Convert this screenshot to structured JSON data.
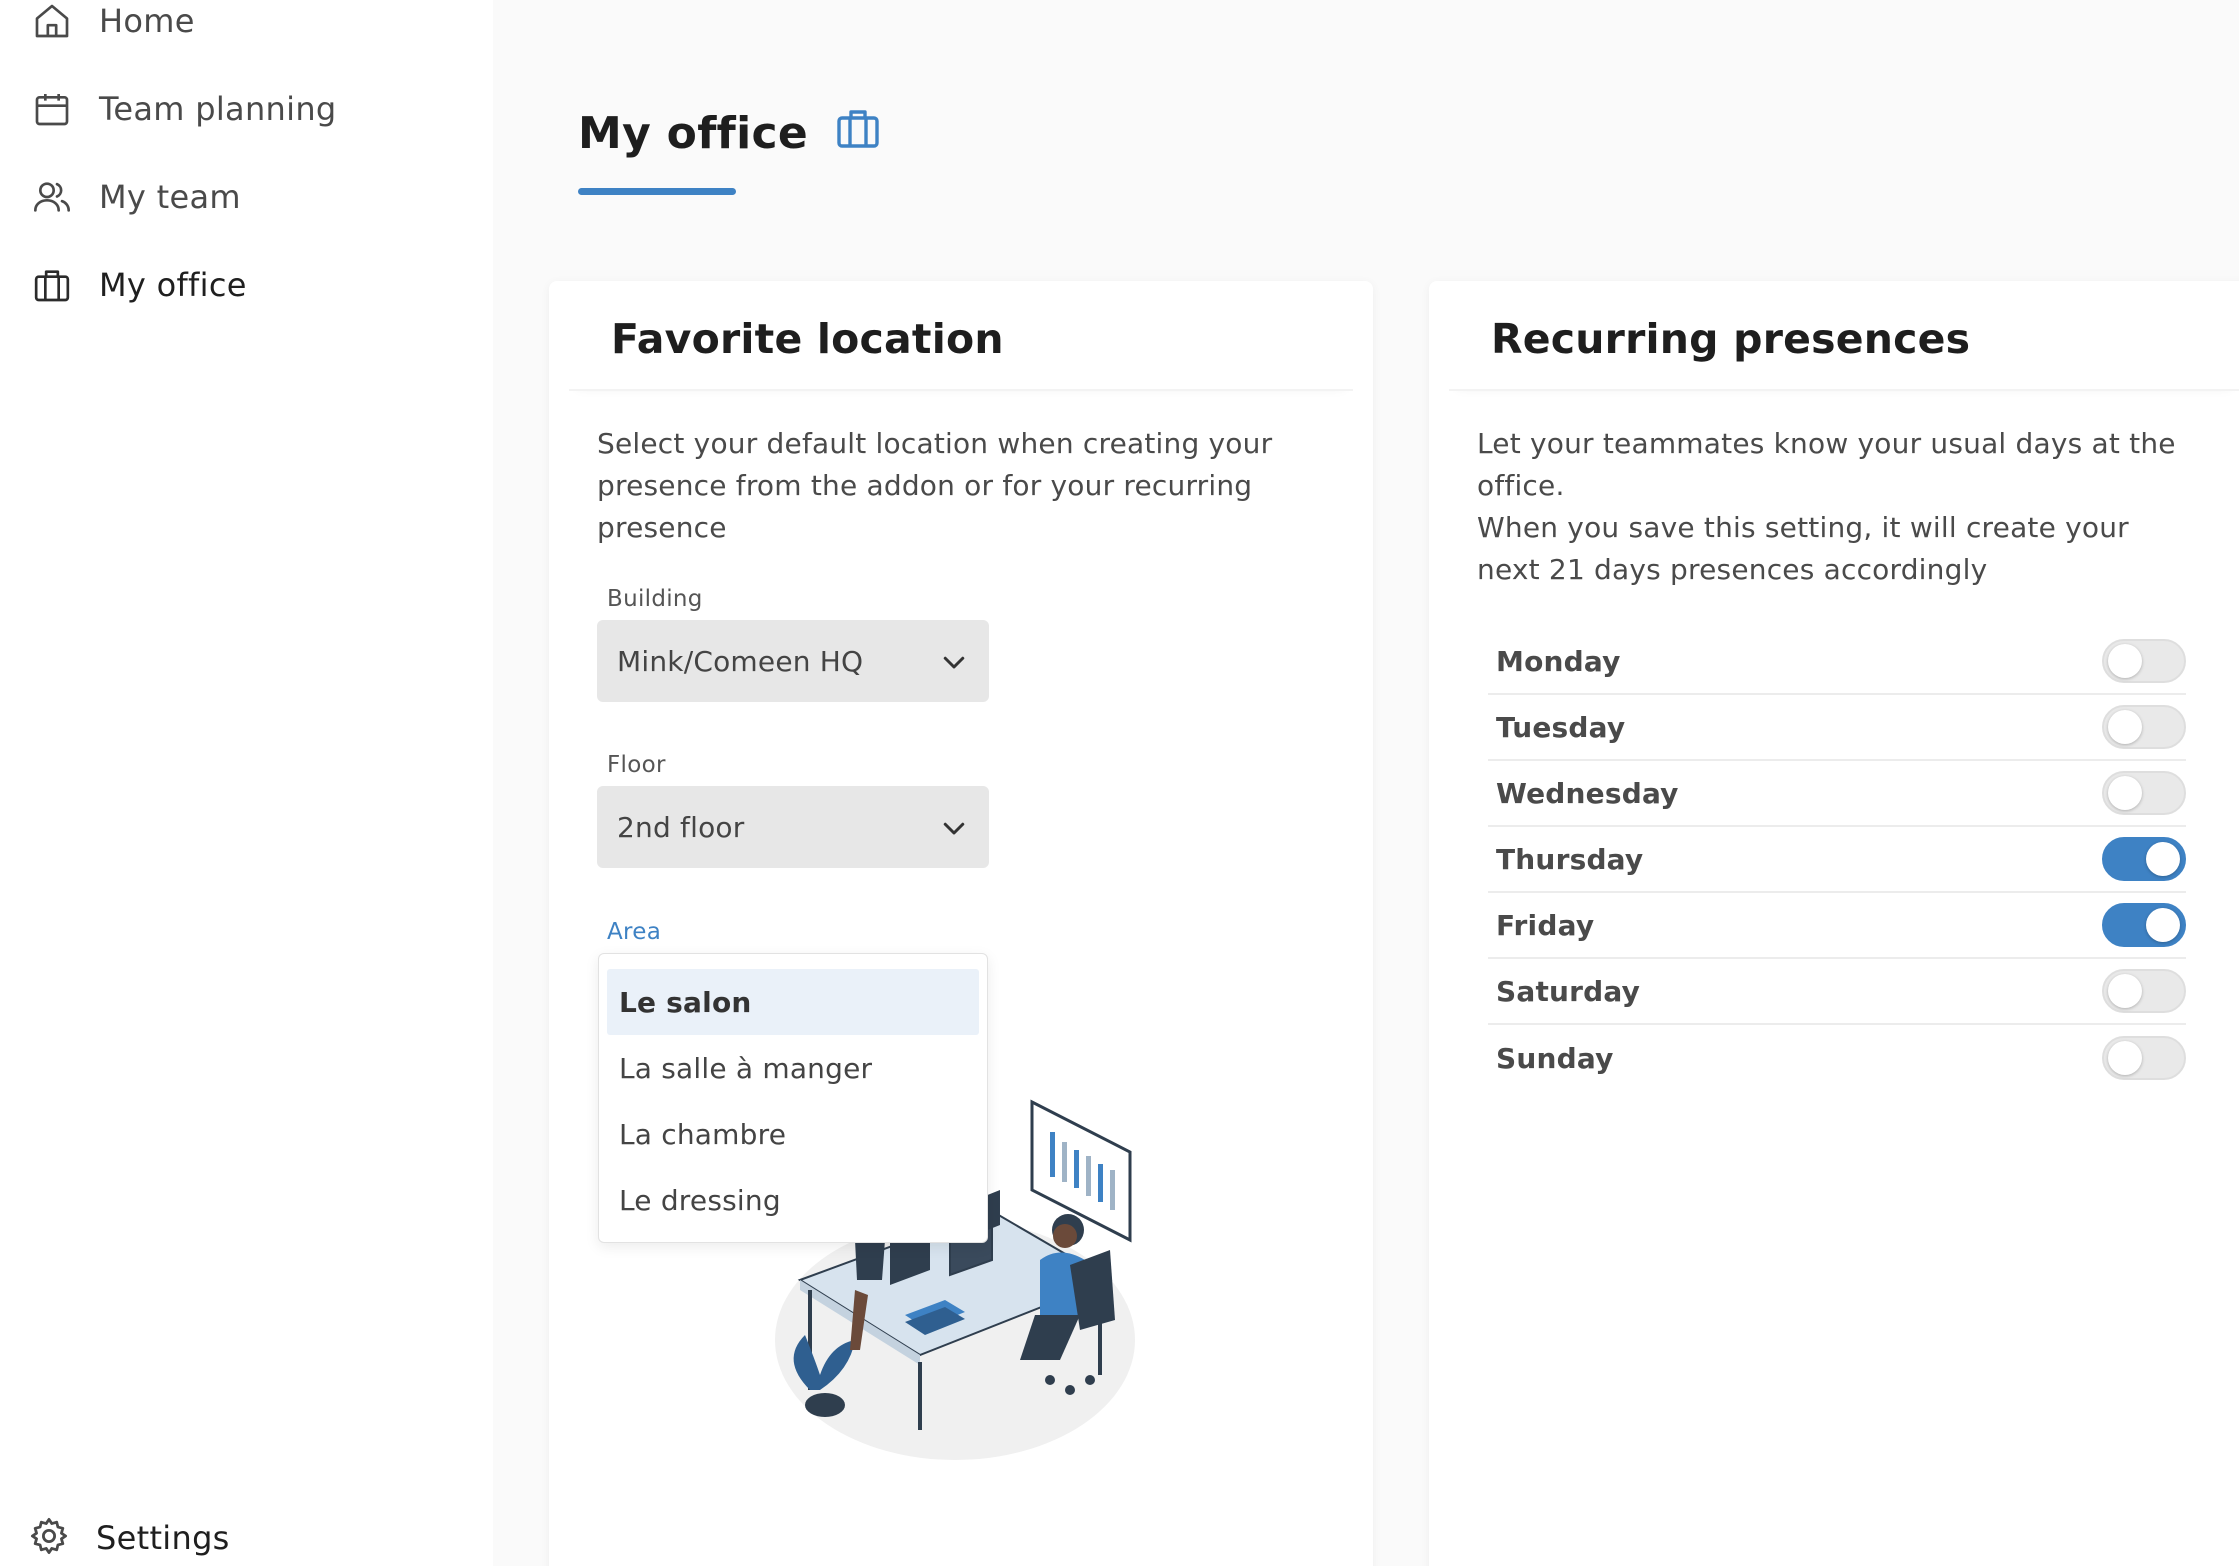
{
  "sidebar": {
    "items": [
      {
        "label": "Home",
        "icon": "home-icon"
      },
      {
        "label": "Team planning",
        "icon": "calendar-icon"
      },
      {
        "label": "My team",
        "icon": "users-icon"
      },
      {
        "label": "My office",
        "icon": "briefcase-icon",
        "active": true
      }
    ],
    "settings_label": "Settings"
  },
  "header": {
    "title": "My office",
    "title_icon": "briefcase-icon"
  },
  "favorite_location": {
    "title": "Favorite location",
    "description": "Select your default location when creating your presence from the addon or for your recurring presence",
    "building": {
      "label": "Building",
      "value": "Mink/Comeen HQ"
    },
    "floor": {
      "label": "Floor",
      "value": "2nd floor"
    },
    "area": {
      "label": "Area",
      "options": [
        "Le salon",
        "La salle à manger",
        "La chambre",
        "Le dressing"
      ],
      "highlighted": "Le salon"
    }
  },
  "recurring_presences": {
    "title": "Recurring presences",
    "description_line1": "Let your teammates know your usual days at the office.",
    "description_line2": "When you save this setting, it will create your next 21 days presences accordingly",
    "days": [
      {
        "label": "Monday",
        "on": false
      },
      {
        "label": "Tuesday",
        "on": false
      },
      {
        "label": "Wednesday",
        "on": false
      },
      {
        "label": "Thursday",
        "on": true
      },
      {
        "label": "Friday",
        "on": true
      },
      {
        "label": "Saturday",
        "on": false
      },
      {
        "label": "Sunday",
        "on": false
      }
    ]
  },
  "colors": {
    "accent": "#3e82c4",
    "toggle_off": "#e9e9e9",
    "select_bg": "#e7e7e7",
    "highlight": "#eaf1f9"
  }
}
